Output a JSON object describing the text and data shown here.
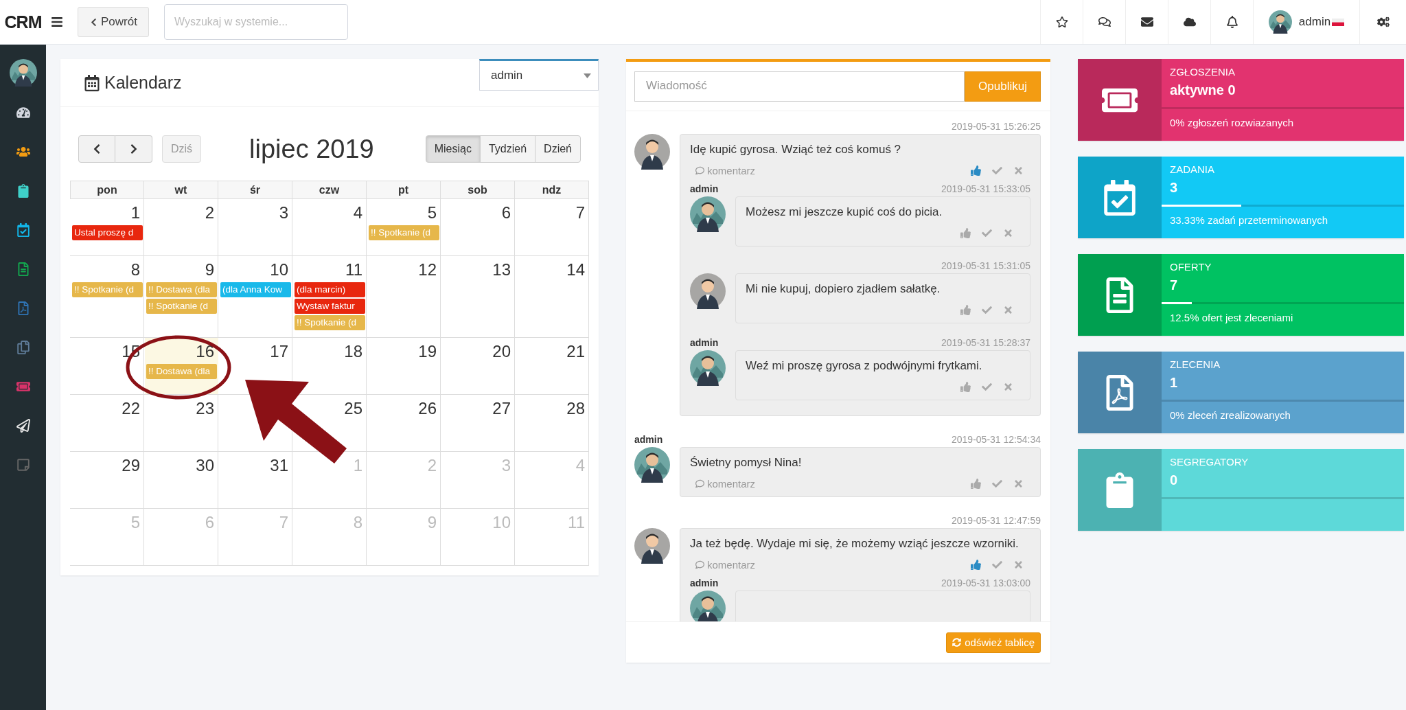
{
  "topbar": {
    "logo": "CRM",
    "back_label": "Powrót",
    "search_placeholder": "Wyszukaj w systemie...",
    "user": "admin"
  },
  "calendar": {
    "title": "Kalendarz",
    "user_select": "admin",
    "today_button": {
      "label": "Dziś",
      "disabled": true
    },
    "month_title": "lipiec 2019",
    "views": [
      {
        "label": "Miesiąc",
        "selected": true
      },
      {
        "label": "Tydzień",
        "selected": false
      },
      {
        "label": "Dzień",
        "selected": false
      }
    ],
    "weekdays": [
      "pon",
      "wt",
      "śr",
      "czw",
      "pt",
      "sob",
      "ndz"
    ],
    "weeks": [
      [
        {
          "kind": "day",
          "day": "1",
          "other_month": false,
          "today": false,
          "events": [
            {
              "text": "Ustal proszę d",
              "color": "#e8270e"
            }
          ]
        },
        {
          "day": "2",
          "other_month": false,
          "today": false
        },
        {
          "day": "3",
          "other_month": false,
          "today": false
        },
        {
          "day": "4",
          "other_month": false,
          "today": false
        },
        {
          "day": "5",
          "other_month": false,
          "today": false,
          "events": [
            {
              "text": "!! Spotkanie (d",
              "color": "#e6b74a"
            }
          ]
        },
        {
          "day": "6",
          "other_month": false,
          "today": false
        },
        {
          "day": "7",
          "other_month": false,
          "today": false
        }
      ],
      [
        {
          "day": "8",
          "other_month": false,
          "today": false,
          "events": [
            {
              "text": "!! Spotkanie (d",
              "color": "#e6b74a"
            }
          ]
        },
        {
          "day": "9",
          "other_month": false,
          "today": false,
          "events": [
            {
              "text": "!! Dostawa (dla",
              "color": "#e6b74a"
            },
            {
              "text": "!! Spotkanie (d",
              "color": "#e6b74a"
            }
          ]
        },
        {
          "day": "10",
          "other_month": false,
          "today": false,
          "events": [
            {
              "text": "(dla Anna Kow",
              "color": "#19b9ea"
            }
          ]
        },
        {
          "day": "11",
          "other_month": false,
          "today": false,
          "events": [
            {
              "text": "(dla marcin)",
              "color": "#e8270e"
            },
            {
              "text": "Wystaw faktur",
              "color": "#e8270e"
            },
            {
              "text": "!! Spotkanie (d",
              "color": "#e6b74a"
            }
          ]
        },
        {
          "day": "12",
          "other_month": false,
          "today": false
        },
        {
          "day": "13",
          "other_month": false,
          "today": false
        },
        {
          "day": "14",
          "other_month": false,
          "today": false
        }
      ],
      [
        {
          "day": "15",
          "other_month": false,
          "today": false
        },
        {
          "day": "16",
          "other_month": false,
          "today": true,
          "events": [
            {
              "text": "!! Dostawa (dla",
              "color": "#e6b74a"
            }
          ]
        },
        {
          "day": "17",
          "other_month": false,
          "today": false
        },
        {
          "day": "18",
          "other_month": false,
          "today": false
        },
        {
          "day": "19",
          "other_month": false,
          "today": false
        },
        {
          "day": "20",
          "other_month": false,
          "today": false
        },
        {
          "day": "21",
          "other_month": false,
          "today": false
        }
      ],
      [
        {
          "day": "22",
          "other_month": false,
          "today": false
        },
        {
          "day": "23",
          "other_month": false,
          "today": false
        },
        {
          "kind": "covered"
        },
        {
          "day": "25",
          "other_month": false,
          "today": false
        },
        {
          "day": "26",
          "other_month": false,
          "today": false
        },
        {
          "day": "27",
          "other_month": false,
          "today": false
        },
        {
          "day": "28",
          "other_month": false,
          "today": false
        }
      ],
      [
        {
          "day": "29",
          "other_month": false,
          "today": false
        },
        {
          "day": "30",
          "other_month": false,
          "today": false
        },
        {
          "day": "31",
          "other_month": false,
          "today": false
        },
        {
          "day": "1",
          "other_month": true,
          "today": false
        },
        {
          "day": "2",
          "other_month": true,
          "today": false
        },
        {
          "day": "3",
          "other_month": true,
          "today": false
        },
        {
          "day": "4",
          "other_month": true,
          "today": false
        }
      ],
      [
        {
          "day": "5",
          "other_month": true,
          "today": false
        },
        {
          "day": "6",
          "other_month": true,
          "today": false
        },
        {
          "day": "7",
          "other_month": true,
          "today": false
        },
        {
          "day": "8",
          "other_month": true,
          "today": false
        },
        {
          "day": "9",
          "other_month": true,
          "today": false
        },
        {
          "day": "10",
          "other_month": true,
          "today": false
        },
        {
          "day": "11",
          "other_month": true,
          "today": false
        }
      ]
    ]
  },
  "feed": {
    "placeholder": "Wiadomość",
    "publish_label": "Opublikuj",
    "refresh_label": "odśwież tablicę",
    "posts": [
      {
        "time": "2019-05-31 15:26:25",
        "text": "Idę kupić gyrosa. Wziąć też coś komuś ?",
        "comment_label": "komentarz",
        "liked": true,
        "replies": [
          {
            "author": "admin",
            "time": "2019-05-31 15:33:05",
            "text": "Możesz mi jeszcze kupić coś do picia.",
            "liked": false
          },
          {
            "time": "2019-05-31 15:31:05",
            "text": "Mi nie kupuj, dopiero zjadłem sałatkę.",
            "liked": false
          },
          {
            "author": "admin",
            "time": "2019-05-31 15:28:37",
            "text": "Weź mi proszę gyrosa z podwójnymi frytkami.",
            "liked": false
          }
        ]
      },
      {
        "author": "admin",
        "time": "2019-05-31 12:54:34",
        "text": "Świetny pomysł Nina!",
        "comment_label": "komentarz",
        "liked": false
      },
      {
        "time": "2019-05-31 12:47:59",
        "text": "Ja też będę. Wydaje mi się, że możemy wziąć jeszcze wzorniki.",
        "comment_label": "komentarz",
        "liked": true,
        "replies": [
          {
            "author": "admin",
            "time": "2019-05-31 13:03:00"
          }
        ]
      }
    ]
  },
  "stats": [
    {
      "title": "ZGŁOSZENIA",
      "value": "aktywne 0",
      "level": 0,
      "footer": "0% zgłoszeń rozwiazanych",
      "color": "#e2336f"
    },
    {
      "title": "ZADANIA",
      "value": "3",
      "level": 0.33,
      "footer": "33.33% zadań przeterminowanych",
      "color": "#12c9f5"
    },
    {
      "title": "OFERTY",
      "value": "7",
      "level": 0.125,
      "footer": "12.5% ofert jest zleceniami",
      "color": "#00c262"
    },
    {
      "title": "ZLECENIA",
      "value": "1",
      "level": 0,
      "footer": "0% zleceń zrealizowanych",
      "color": "#5ba2cd"
    },
    {
      "title": "SEGREGATORY",
      "value": "0",
      "level": 0,
      "color": "#5dd9d9"
    }
  ],
  "annotations": [
    {
      "kind": "circle"
    },
    {
      "kind": "arrow"
    }
  ]
}
